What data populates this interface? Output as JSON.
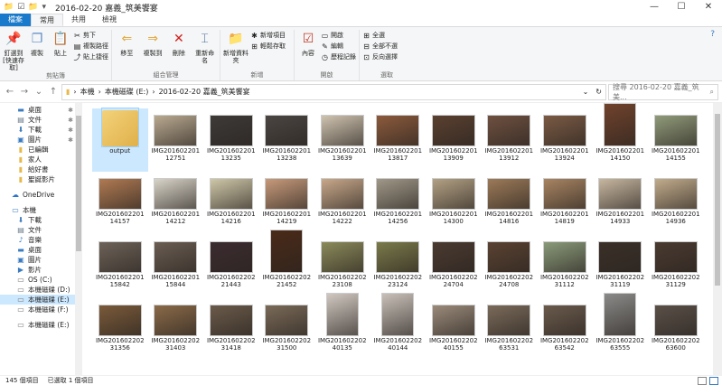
{
  "title": {
    "path": "2016-02-20 嘉義_筑美饗宴"
  },
  "tabs": {
    "file": "檔案",
    "home": "常用",
    "share": "共用",
    "view": "檢視"
  },
  "ribbon": {
    "clipboard": {
      "label": "剪貼簿",
      "pin": "釘選到[快速存取]",
      "copy": "複製",
      "paste": "貼上",
      "cut": "剪下",
      "copy_path": "複製路徑",
      "paste_shortcut": "貼上捷徑"
    },
    "organize": {
      "label": "組合管理",
      "move": "移至",
      "copy_to": "複製到",
      "delete": "刪除",
      "rename": "重新命名"
    },
    "new": {
      "label": "新增",
      "folder": "新增資料夾",
      "item": "新增項目",
      "easy": "輕鬆存取"
    },
    "open": {
      "label": "開啟",
      "props": "內容",
      "open": "開啟",
      "edit": "編輯",
      "history": "歷程記錄"
    },
    "select": {
      "label": "選取",
      "all": "全選",
      "none": "全部不選",
      "invert": "反向選擇"
    }
  },
  "address": {
    "crumbs": [
      "本機",
      "本機磁碟 (E:)",
      "2016-02-20 嘉義_筑美饗宴"
    ],
    "search_placeholder": "搜尋 2016-02-20 嘉義_筑美..."
  },
  "nav": [
    {
      "label": "桌面",
      "icon": "desktop-icon",
      "pin": true
    },
    {
      "label": "文件",
      "icon": "documents-icon",
      "pin": true
    },
    {
      "label": "下載",
      "icon": "downloads-icon",
      "pin": true
    },
    {
      "label": "圖片",
      "icon": "pictures-icon",
      "pin": true
    },
    {
      "label": "已編輯",
      "icon": "folder-icon"
    },
    {
      "label": "家人",
      "icon": "folder-icon"
    },
    {
      "label": "給好書",
      "icon": "folder-icon"
    },
    {
      "label": "聖誕影片",
      "icon": "folder-icon"
    },
    {
      "label": "OneDrive",
      "icon": "onedrive-icon",
      "lvl0": true,
      "gap": true
    },
    {
      "label": "本機",
      "icon": "pc-icon",
      "lvl0": true,
      "gap": true
    },
    {
      "label": "下載",
      "icon": "downloads-icon"
    },
    {
      "label": "文件",
      "icon": "documents-icon"
    },
    {
      "label": "音樂",
      "icon": "music-icon"
    },
    {
      "label": "桌面",
      "icon": "desktop-icon"
    },
    {
      "label": "圖片",
      "icon": "pictures-icon"
    },
    {
      "label": "影片",
      "icon": "videos-icon"
    },
    {
      "label": "OS (C:)",
      "icon": "drive-icon"
    },
    {
      "label": "本機磁碟 (D:)",
      "icon": "drive-icon"
    },
    {
      "label": "本機磁碟 (E:)",
      "icon": "drive-icon",
      "sel": true
    },
    {
      "label": "本機磁碟 (F:)",
      "icon": "drive-icon"
    },
    {
      "label": "本機磁碟 (E:)",
      "icon": "drive-icon",
      "gap": true
    }
  ],
  "files": [
    {
      "l1": "output",
      "l2": "",
      "folder": true,
      "sel": true
    },
    {
      "l1": "IMG201602201",
      "l2": "12751",
      "c": "#b9a990",
      "w": 48,
      "h": 35
    },
    {
      "l1": "IMG201602201",
      "l2": "13235",
      "c": "#3d3a38",
      "w": 48,
      "h": 35
    },
    {
      "l1": "IMG201602201",
      "l2": "13238",
      "c": "#4a4542",
      "w": 48,
      "h": 35
    },
    {
      "l1": "IMG201602201",
      "l2": "13639",
      "c": "#cfc3b0",
      "w": 48,
      "h": 35
    },
    {
      "l1": "IMG201602201",
      "l2": "13817",
      "c": "#8b5a3c",
      "w": 48,
      "h": 35
    },
    {
      "l1": "IMG201602201",
      "l2": "13909",
      "c": "#5a4030",
      "w": 48,
      "h": 35
    },
    {
      "l1": "IMG201602201",
      "l2": "13912",
      "c": "#6e5040",
      "w": 48,
      "h": 35
    },
    {
      "l1": "IMG201602201",
      "l2": "13924",
      "c": "#7a5a44",
      "w": 48,
      "h": 35
    },
    {
      "l1": "IMG201602201",
      "l2": "14150",
      "c": "#70422c",
      "w": 36,
      "h": 48
    },
    {
      "l1": "IMG201602201",
      "l2": "14155",
      "c": "#909b7a",
      "w": 48,
      "h": 35
    },
    {
      "l1": "IMG201602201",
      "l2": "14157",
      "c": "#b07a52",
      "w": 48,
      "h": 35
    },
    {
      "l1": "IMG201602201",
      "l2": "14212",
      "c": "#d9d4c8",
      "w": 48,
      "h": 35
    },
    {
      "l1": "IMG201602201",
      "l2": "14216",
      "c": "#cfc7a8",
      "w": 48,
      "h": 35
    },
    {
      "l1": "IMG201602201",
      "l2": "14219",
      "c": "#c79a7a",
      "w": 48,
      "h": 35
    },
    {
      "l1": "IMG201602201",
      "l2": "14222",
      "c": "#c8a88a",
      "w": 48,
      "h": 35
    },
    {
      "l1": "IMG201602201",
      "l2": "14256",
      "c": "#a09888",
      "w": 48,
      "h": 35
    },
    {
      "l1": "IMG201602201",
      "l2": "14300",
      "c": "#b3a184",
      "w": 48,
      "h": 35
    },
    {
      "l1": "IMG201602201",
      "l2": "14816",
      "c": "#9c7a58",
      "w": 48,
      "h": 35
    },
    {
      "l1": "IMG201602201",
      "l2": "14819",
      "c": "#a88462",
      "w": 48,
      "h": 35
    },
    {
      "l1": "IMG201602201",
      "l2": "14933",
      "c": "#c7b7a0",
      "w": 48,
      "h": 35
    },
    {
      "l1": "IMG201602201",
      "l2": "14936",
      "c": "#c2ac8c",
      "w": 48,
      "h": 35
    },
    {
      "l1": "IMG201602201",
      "l2": "15842",
      "c": "#6d6258",
      "w": 48,
      "h": 35
    },
    {
      "l1": "IMG201602201",
      "l2": "15844",
      "c": "#6a5d52",
      "w": 48,
      "h": 35
    },
    {
      "l1": "IMG201602202",
      "l2": "21443",
      "c": "#3c2c30",
      "w": 48,
      "h": 35
    },
    {
      "l1": "IMG201602202",
      "l2": "21452",
      "c": "#4a2a18",
      "w": 36,
      "h": 48
    },
    {
      "l1": "IMG201602202",
      "l2": "23108",
      "c": "#8a8a5a",
      "w": 48,
      "h": 35
    },
    {
      "l1": "IMG201602202",
      "l2": "23124",
      "c": "#7a7a4a",
      "w": 48,
      "h": 35
    },
    {
      "l1": "IMG201602202",
      "l2": "24704",
      "c": "#4a3a30",
      "w": 48,
      "h": 35
    },
    {
      "l1": "IMG201602202",
      "l2": "24708",
      "c": "#5a4232",
      "w": 48,
      "h": 35
    },
    {
      "l1": "IMG201602202",
      "l2": "31112",
      "c": "#8a9a7a",
      "w": 48,
      "h": 35
    },
    {
      "l1": "IMG201602202",
      "l2": "31119",
      "c": "#3a3028",
      "w": 48,
      "h": 35
    },
    {
      "l1": "IMG201602202",
      "l2": "31129",
      "c": "#4a3a30",
      "w": 48,
      "h": 35
    },
    {
      "l1": "IMG201602202",
      "l2": "31356",
      "c": "#7a5a3a",
      "w": 48,
      "h": 35
    },
    {
      "l1": "IMG201602202",
      "l2": "31403",
      "c": "#8a6a48",
      "w": 48,
      "h": 35
    },
    {
      "l1": "IMG201602202",
      "l2": "31418",
      "c": "#6a5a4a",
      "w": 48,
      "h": 35
    },
    {
      "l1": "IMG201602202",
      "l2": "31500",
      "c": "#7a6a58",
      "w": 48,
      "h": 35
    },
    {
      "l1": "IMG201602202",
      "l2": "40135",
      "c": "#d0c8c0",
      "w": 36,
      "h": 48
    },
    {
      "l1": "IMG201602202",
      "l2": "40144",
      "c": "#c8c0b8",
      "w": 36,
      "h": 48
    },
    {
      "l1": "IMG201602202",
      "l2": "40155",
      "c": "#9a8a7a",
      "w": 48,
      "h": 35
    },
    {
      "l1": "IMG201602202",
      "l2": "63531",
      "c": "#7a6a5a",
      "w": 48,
      "h": 35
    },
    {
      "l1": "IMG201602202",
      "l2": "63542",
      "c": "#6a5a4c",
      "w": 48,
      "h": 35
    },
    {
      "l1": "IMG201602202",
      "l2": "63555",
      "c": "#8a8a88",
      "w": 36,
      "h": 48
    },
    {
      "l1": "IMG201602202",
      "l2": "63600",
      "c": "#5a5048",
      "w": 48,
      "h": 35
    }
  ],
  "status": {
    "count": "145 個項目",
    "selected": "已選取 1 個項目"
  }
}
